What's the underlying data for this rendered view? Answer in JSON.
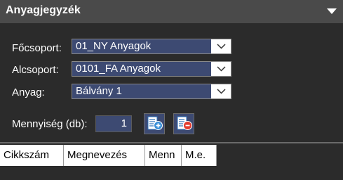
{
  "panel": {
    "title": "Anyagjegyzék"
  },
  "form": {
    "focsoport_label": "Főcsoport:",
    "focsoport_value": "01_NY Anyagok",
    "alcsoport_label": "Alcsoport:",
    "alcsoport_value": "0101_FA Anyagok",
    "anyag_label": "Anyag:",
    "anyag_value": "Bálvány 1",
    "mennyiseg_label": "Mennyiség (db):",
    "mennyiseg_value": "1"
  },
  "buttons": {
    "add_icon": "add-document-icon",
    "remove_icon": "remove-document-icon"
  },
  "table": {
    "columns": [
      "Cikkszám",
      "Megnevezés",
      "Menn",
      "M.e."
    ]
  },
  "colors": {
    "background": "#2b2b2b",
    "titlebar": "#4a4a4a",
    "field": "#3d4a72",
    "add_accent": "#3a8fd8",
    "remove_accent": "#e23b2e"
  }
}
